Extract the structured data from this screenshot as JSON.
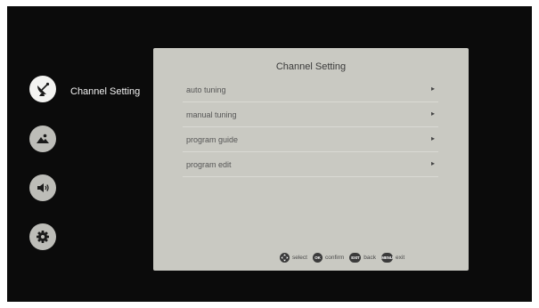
{
  "sidebar": {
    "items": [
      {
        "icon": "satellite-dish-icon",
        "label": "Channel Setting",
        "active": true
      },
      {
        "icon": "picture-icon",
        "label": "",
        "active": false
      },
      {
        "icon": "speaker-icon",
        "label": "",
        "active": false
      },
      {
        "icon": "gear-icon",
        "label": "",
        "active": false
      }
    ]
  },
  "panel": {
    "title": "Channel Setting",
    "items": [
      {
        "label": "auto tuning",
        "arrow": "▸"
      },
      {
        "label": "manual tuning",
        "arrow": "▸"
      },
      {
        "label": "program guide",
        "arrow": "▸"
      },
      {
        "label": "program edit",
        "arrow": "▸"
      }
    ]
  },
  "footer": {
    "hints": [
      {
        "key_icon": "dpad-icon",
        "key_text": "",
        "label": "select"
      },
      {
        "key_icon": "ok-key-icon",
        "key_text": "OK",
        "label": "confirm"
      },
      {
        "key_icon": "exit-key-icon",
        "key_text": "EXIT",
        "label": "back"
      },
      {
        "key_icon": "menu-key-icon",
        "key_text": "MENU",
        "label": "exit"
      }
    ]
  },
  "colors": {
    "background": "#0b0b0b",
    "panel": "#c9c9c2",
    "sidebar_icon": "#bdbdb8",
    "sidebar_icon_active": "#f3f3f1"
  }
}
